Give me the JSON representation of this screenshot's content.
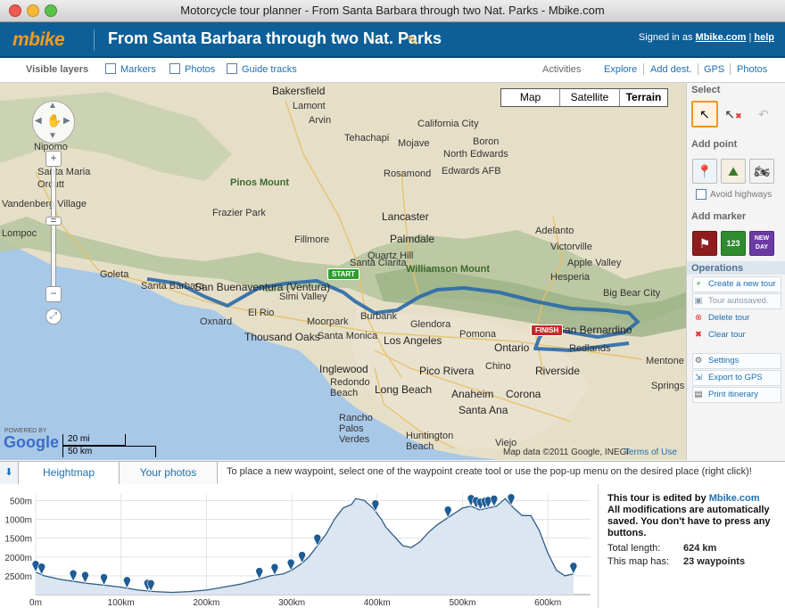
{
  "window": {
    "title": "Motorcycle tour planner - From Santa Barbara through two Nat. Parks - Mbike.com"
  },
  "header": {
    "logo": "mbike",
    "tour_title": "From Santa Barbara through two Nat. Parks",
    "signed_prefix": "Signed in as",
    "user": "Mbike.com",
    "sep": "|",
    "help": "help"
  },
  "layers": {
    "label": "Visible layers",
    "items": [
      "Markers",
      "Photos",
      "Guide tracks"
    ]
  },
  "activities": {
    "label": "Activities",
    "links": [
      "Explore",
      "Add dest.",
      "GPS",
      "Photos"
    ]
  },
  "map": {
    "types": [
      "Map",
      "Satellite",
      "Terrain"
    ],
    "selected_type": "Terrain",
    "scale": {
      "mi": "20 mi",
      "km": "50 km"
    },
    "powered_by": "POWERED BY",
    "google": "Google",
    "copyright": "Map data ©2011 Google, INEGI",
    "terms": "Terms of Use",
    "start_label": "START",
    "finish_label": "FINISH",
    "places": [
      "Bakersfield",
      "Lamont",
      "Arvin",
      "Tehachapi",
      "California City",
      "Boron",
      "Mojave",
      "North Edwards",
      "Rosamond",
      "Edwards AFB",
      "Santa Maria",
      "Orcutt",
      "Nipomo",
      "Lompoc",
      "Vandenberg Village",
      "Pinos Mount",
      "Lancaster",
      "Palmdale",
      "Victorville",
      "Hesperia",
      "Apple Valley",
      "Big Bear City",
      "Williamson Mount",
      "Goleta",
      "Santa Barbara",
      "San Buenaventura (Ventura)",
      "Simi Valley",
      "Santa Clarita",
      "Burbank",
      "Glendora",
      "Oxnard",
      "El Rio",
      "Thousand Oaks",
      "Santa Monica",
      "Los Angeles",
      "Pomona",
      "Ontario",
      "San Bernardino",
      "Redlands",
      "Inglewood",
      "Pico Rivera",
      "Chino",
      "Riverside",
      "Redondo Beach",
      "Long Beach",
      "Anaheim",
      "Corona",
      "Santa Ana",
      "Rancho Palos Verdes",
      "Huntington Beach",
      "Viejo",
      "Springs",
      "Mentone",
      "Adelanto",
      "Quartz Hill",
      "Frazier Park",
      "Fillmore",
      "Moorpark"
    ]
  },
  "right_panel": {
    "select": "Select",
    "add_point": "Add point",
    "avoid_highways": "Avoid highways",
    "add_marker": "Add marker",
    "operations": "Operations",
    "ops": [
      "Create a new tour",
      "Tour autosaved.",
      "Delete tour",
      "Clear tour"
    ],
    "tools": [
      "Settings",
      "Export to GPS",
      "Print itinerary"
    ]
  },
  "tabs": {
    "heightmap": "Heightmap",
    "photos": "Your photos",
    "hint": "To place a new waypoint, select one of the waypoint create tool or use the pop-up menu on the desired place (right click)!"
  },
  "elevation": {
    "y_ticks": [
      "2500m",
      "2000m",
      "1500m",
      "1000m",
      "500m"
    ],
    "x_ticks": [
      "0m",
      "100km",
      "200km",
      "300km",
      "400km",
      "500km",
      "600km"
    ]
  },
  "info": {
    "line1_prefix": "This tour is edited by",
    "editor": "Mbike.com",
    "line2": "All modifications are automatically saved. You don't have to press any buttons.",
    "length_label": "Total length:",
    "length_value": "624 km",
    "waypoints_label": "This map has:",
    "waypoints_value": "23 waypoints"
  },
  "chart_data": {
    "type": "area",
    "title": "",
    "xlabel": "",
    "ylabel": "",
    "xlim": [
      0,
      650
    ],
    "ylim": [
      0,
      2700
    ],
    "x_ticks": [
      0,
      100,
      200,
      300,
      400,
      500,
      600
    ],
    "y_ticks": [
      500,
      1000,
      1500,
      2000,
      2500
    ],
    "x": [
      0,
      10,
      20,
      30,
      45,
      60,
      80,
      100,
      120,
      140,
      160,
      180,
      200,
      220,
      240,
      260,
      275,
      290,
      300,
      310,
      320,
      330,
      340,
      350,
      360,
      370,
      375,
      385,
      395,
      405,
      410,
      420,
      430,
      440,
      450,
      460,
      470,
      480,
      490,
      500,
      510,
      520,
      530,
      540,
      550,
      560,
      570,
      580,
      590,
      600,
      610,
      620,
      630
    ],
    "y": [
      600,
      500,
      450,
      400,
      350,
      300,
      250,
      200,
      120,
      80,
      60,
      80,
      120,
      200,
      280,
      400,
      500,
      550,
      650,
      800,
      1000,
      1300,
      1600,
      2000,
      2300,
      2400,
      2550,
      2500,
      2300,
      2000,
      1800,
      1550,
      1300,
      1250,
      1400,
      1650,
      1850,
      2000,
      2150,
      2300,
      2350,
      2250,
      2300,
      2350,
      2550,
      2300,
      2100,
      2100,
      1700,
      1100,
      650,
      500,
      550
    ],
    "waypoints_km": [
      0,
      7,
      44,
      58,
      80,
      107,
      131,
      135,
      262,
      280,
      299,
      312,
      330,
      398,
      483,
      510,
      516,
      521,
      526,
      530,
      537,
      557,
      630
    ]
  }
}
